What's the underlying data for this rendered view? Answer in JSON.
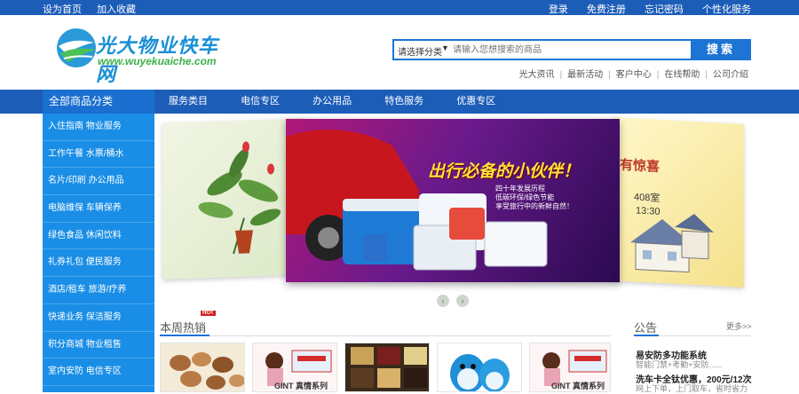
{
  "topbar": {
    "left": [
      "设为首页",
      "加入收藏"
    ],
    "right": [
      "登录",
      "免费注册",
      "忘记密码",
      "个性化服务"
    ]
  },
  "logo": {
    "title": "光大物业快车网",
    "subtitle": "www.wuyekuaiche.com"
  },
  "search": {
    "category": "请选择分类",
    "placeholder": "请输入您想搜索的商品",
    "button": "搜索"
  },
  "quicklinks": [
    "光大资讯",
    "最新活动",
    "客户中心",
    "在线帮助",
    "公司介绍"
  ],
  "nav": {
    "all_categories": "全部商品分类",
    "items": [
      "服务类目",
      "电信专区",
      "办公用品",
      "特色服务",
      "优惠专区"
    ]
  },
  "sidebar": {
    "items": [
      "入住指南 物业服务",
      "工作午餐 水票/桶水",
      "名片/印刷 办公用品",
      "电脑维保 车辆保养",
      "绿色食品 休闲饮料",
      "礼券礼包 便民服务",
      "酒店/租车 旅游/疗养",
      "快递业务 保洁服务",
      "积分商城 物业租售",
      "室内安防 电信专区"
    ]
  },
  "carousel": {
    "main_headline": "出行必备的小伙伴！",
    "main_sub1": "四十年发展历程",
    "main_sub2": "低碳环保/绿色节能",
    "main_sub3": "享受旅行中的新鲜自然！",
    "right_text1": "有惊喜",
    "right_text2": "408室",
    "right_text3": "13:30"
  },
  "hot": {
    "title": "本周热销",
    "badge": "HOT",
    "products": [
      {
        "caption": ""
      },
      {
        "caption": "GINT 真情系列"
      },
      {
        "caption": ""
      },
      {
        "caption": ""
      },
      {
        "caption": "GINT 真情系列"
      }
    ]
  },
  "notice": {
    "title": "公告",
    "more": "更多>>",
    "items": [
      {
        "title": "易安防多功能系统",
        "desc": "智能门禁+考勤+安防......"
      },
      {
        "title": "洗车卡全钛优惠，200元/12次",
        "desc": "网上下单，上门取车，省时省力"
      }
    ]
  },
  "colors": {
    "primary_blue": "#1c5db8",
    "sidebar_blue": "#1a8ee6",
    "search_blue": "#1c74d4",
    "hot_red": "#d42020"
  }
}
